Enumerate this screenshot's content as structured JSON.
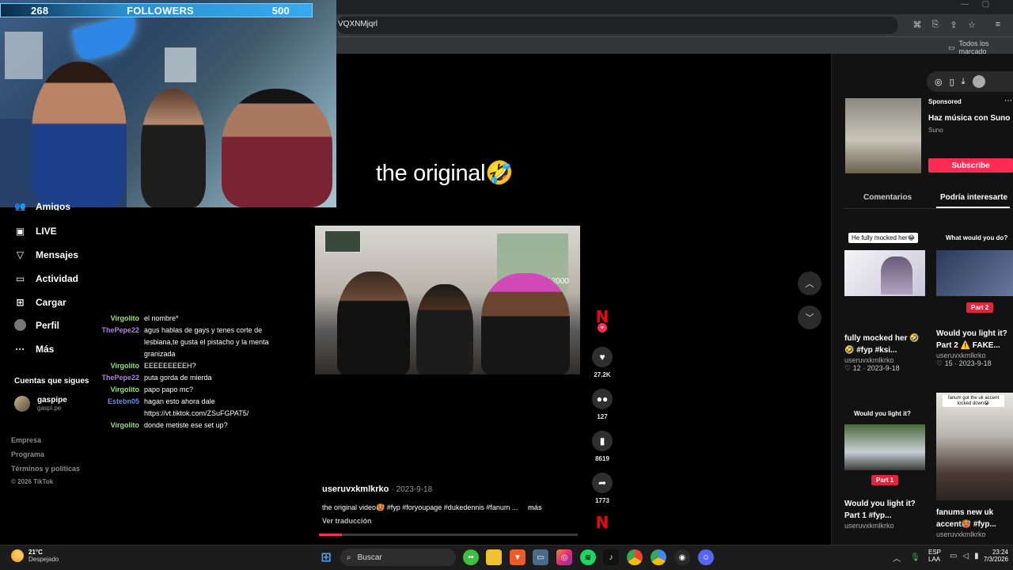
{
  "browser": {
    "url_fragment": "VQXNMjqrl",
    "bookmark": "Todos los marcado"
  },
  "webcam": {
    "bar_left": "268",
    "bar_label": "FOLLOWERS",
    "bar_right": "500"
  },
  "sidebar": {
    "items": [
      {
        "label": "Amigos",
        "icon": "friends-icon"
      },
      {
        "label": "LIVE",
        "icon": "live-icon"
      },
      {
        "label": "Mensajes",
        "icon": "messages-icon"
      },
      {
        "label": "Actividad",
        "icon": "activity-icon"
      },
      {
        "label": "Cargar",
        "icon": "upload-icon"
      },
      {
        "label": "Perfil",
        "icon": "profile-icon"
      },
      {
        "label": "Más",
        "icon": "more-icon"
      }
    ],
    "following_title": "Cuentas que sigues",
    "following": [
      {
        "name": "gaspipe",
        "handle": "gaspi.pe"
      }
    ],
    "footer": [
      "Empresa",
      "Programa",
      "Términos y políticas",
      "© 2026 TikTok"
    ]
  },
  "chat": [
    {
      "user": "Virgolito",
      "color": "#9be37a",
      "msg": "el nombre*"
    },
    {
      "user": "ThePepe22",
      "color": "#b97af0",
      "msg": "agus hablas de gays y tenes corte de lesbiana,te gusta el pistacho y la menta granizada"
    },
    {
      "user": "Virgolito",
      "color": "#9be37a",
      "msg": "EEEEEEEEEH?"
    },
    {
      "user": "ThePepe22",
      "color": "#b97af0",
      "msg": "puta gorda de mierda"
    },
    {
      "user": "Virgolito",
      "color": "#9be37a",
      "msg": "papo papo mc?"
    },
    {
      "user": "Estebn05",
      "color": "#5b8cf0",
      "msg": "hagan esto ahora dale https://vt.tiktok.com/ZSuFGPAT5/"
    },
    {
      "user": "Virgolito",
      "color": "#9be37a",
      "msg": "donde metiste ese set up?"
    }
  ],
  "video": {
    "caption": "the original🤣",
    "overlay_text": "9138 / 2000",
    "username": "useruvxkmlkrko",
    "date": "2023-9-18",
    "description": "the original video🥵 #fyp #foryoupage #dukedennis #fanum ...",
    "more": "más",
    "translate": "Ver traducción",
    "progress": 0.09,
    "actions": {
      "likes": "27.2K",
      "comments": "127",
      "saves": "8619",
      "shares": "1773"
    }
  },
  "right_panel": {
    "sponsored": "Sponsored",
    "ad_title": "Haz música con Suno",
    "ad_brand": "Suno",
    "subscribe": "Subscribe",
    "tabs": [
      "Comentarios",
      "Podría interesarte"
    ],
    "cards": [
      {
        "thumb_label": "He fully mocked her😂",
        "title": "fully mocked her 🤣🤣 #fyp #ksi...",
        "user": "useruvxkmlkrko",
        "likes": "♡ 12",
        "date": "2023-9-18"
      },
      {
        "thumb_label": "What would you do?",
        "tag": "Part 2",
        "title": "Would you light it? Part 2 ⚠️ FAKE...",
        "user": "useruvxkmlkrko",
        "likes": "♡ 15",
        "date": "2023-9-18"
      },
      {
        "thumb_label": "Would you light it?",
        "tag": "Part 1",
        "title": "Would you light it? Part 1 #fyp...",
        "user": "useruvxkmlkrko"
      },
      {
        "thumb_label": "fanum got the uk accent locked down😭",
        "title": "fanums new uk accent🥵 #fyp...",
        "user": "useruvxkmlkrko"
      }
    ]
  },
  "taskbar": {
    "weather_temp": "21°C",
    "weather_desc": "Despejado",
    "search": "Buscar",
    "lang": "ESP",
    "lang_sub": "LAA",
    "time": "23:24",
    "date": "7/3/2026"
  }
}
